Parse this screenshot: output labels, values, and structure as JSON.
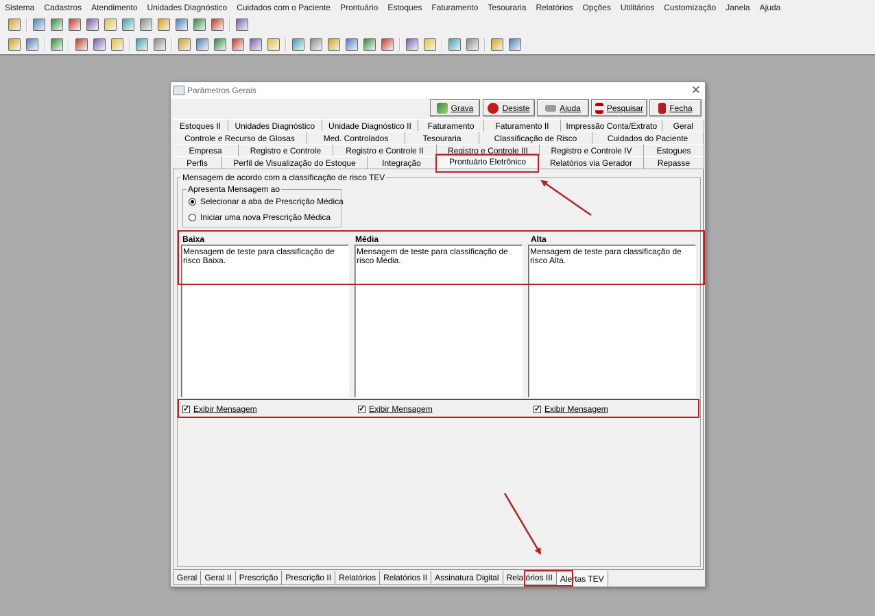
{
  "menu": [
    "Sistema",
    "Cadastros",
    "Atendimento",
    "Unidades Diagnóstico",
    "Cuidados com o Paciente",
    "Prontuário",
    "Estoques",
    "Faturamento",
    "Tesouraria",
    "Relatórios",
    "Opções",
    "Utilitários",
    "Customização",
    "Janela",
    "Ajuda"
  ],
  "dialog": {
    "title": "Parâmetros Gerais",
    "close_glyph": "✕",
    "buttons": {
      "grava": "Grava",
      "desiste": "Desiste",
      "ajuda": "Ajuda",
      "pesquisar": "Pesquisar",
      "fecha": "Fecha"
    },
    "tabs_row1": [
      "Estoques II",
      "Unidades Diagnóstico",
      "Unidade Diagnóstico II",
      "Faturamento",
      "Faturamento II",
      "Impressão Conta/Extrato",
      "Geral"
    ],
    "tabs_row2": [
      "Controle e Recurso de Glosas",
      "Med. Controlados",
      "Tesouraria",
      "Classificação de Risco",
      "Cuidados do Paciente"
    ],
    "tabs_row3": [
      "Empresa",
      "Registro e Controle",
      "Registro e Controle II",
      "Registro e Controle III",
      "Registro e Controle IV",
      "Estogues"
    ],
    "tabs_row4": [
      "Perfis",
      "Perfil de Visualização do Estoque",
      "Integração",
      "Prontuário Eletrônico",
      "Relatórios via Gerador",
      "Repasse"
    ],
    "section_title": "Mensagem de acordo com a classificação de risco TEV",
    "apresenta": {
      "label": "Apresenta Mensagem ao",
      "options": [
        "Selecionar a aba de Prescrição Médica",
        "Iniciar uma nova Prescrição Médica"
      ],
      "selected": 0
    },
    "columns": [
      {
        "label": "Baixa",
        "message": "Mensagem de teste para classificação de risco Baixa.",
        "checkbox": "Exibir Mensagem",
        "checked": true
      },
      {
        "label": "Média",
        "message": "Mensagem de teste para classificação de risco Média.",
        "checkbox": "Exibir Mensagem",
        "checked": true
      },
      {
        "label": "Alta",
        "message": "Mensagem de teste para classificação de risco Alta.",
        "checkbox": "Exibir Mensagem",
        "checked": true
      }
    ],
    "bottom_tabs": [
      "Geral",
      "Geral II",
      "Prescrição",
      "Prescrição II",
      "Relatórios",
      "Relatórios II",
      "Assinatura Digital",
      "Relatórios III",
      "Alertas TEV"
    ],
    "selected_bottom_tab": "Alertas TEV"
  },
  "colors": {
    "highlight": "#b22424",
    "background": "#ababab"
  }
}
